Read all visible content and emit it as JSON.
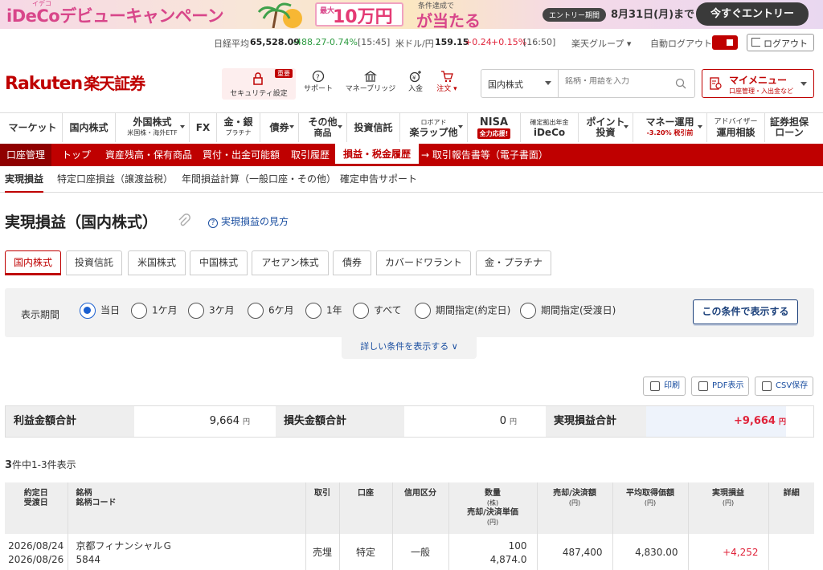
{
  "banner": {
    "title": "iDeCoデビューキャンペーン",
    "ruby": "イデコ",
    "prize_small": "最大",
    "prize_amount": "10万円",
    "condition": "条件達成で",
    "atari": "が当たる",
    "period_tag": "エントリー期間",
    "period_date": "8月31日(月)まで",
    "cta": "今すぐエントリー"
  },
  "ticker": {
    "nikkei_label": "日経平均",
    "nikkei_value": "65,528.09",
    "nikkei_change": "-488.27",
    "nikkei_pct": "-0.74%",
    "nikkei_time": "[15:45]",
    "usdjpy_label": "米ドル/円",
    "usdjpy_value": "159.15",
    "usdjpy_change": "+0.24",
    "usdjpy_pct": "+0.15%",
    "usdjpy_time": "[16:50]",
    "group_label": "楽天グループ ▾",
    "auto_logout_label": "自動ログアウト",
    "logout_button": "ログアウト"
  },
  "header": {
    "logo_en": "Rakuten",
    "logo_jp": "楽天証券",
    "security_label": "セキュリティ設定",
    "security_badge": "重要",
    "icons": [
      {
        "name": "サポート"
      },
      {
        "name": "マネーブリッジ"
      },
      {
        "name": "入金"
      },
      {
        "name": "注文 ▾"
      }
    ],
    "search_select": "国内株式",
    "search_placeholder": "銘柄・用語を入力",
    "mymenu_title": "マイメニュー",
    "mymenu_sub": "口座管理・入出金など"
  },
  "nav": [
    {
      "line1": "マーケット",
      "line2": ""
    },
    {
      "line1": "国内株式",
      "line2": ""
    },
    {
      "line1": "外国株式",
      "line2": "米国株・海外ETF"
    },
    {
      "line1": "FX",
      "line2": ""
    },
    {
      "line1": "金・銀",
      "line2": "プラチナ"
    },
    {
      "line1": "債券",
      "line2": ""
    },
    {
      "line1": "その他",
      "line2": "商品"
    },
    {
      "line1": "投資信託",
      "line2": ""
    },
    {
      "line1": "ロボアド",
      "line2": "楽ラップ他"
    },
    {
      "line1": "NISA",
      "line2": "全力応援!"
    },
    {
      "line1": "確定拠出年金",
      "line2": "iDeCo"
    },
    {
      "line1": "ポイント",
      "line2": "投資"
    },
    {
      "line1": "マネー運用",
      "line2": "-3.20% 税引前"
    },
    {
      "line1": "アドバイザー",
      "line2": "運用相談"
    },
    {
      "line1": "証券担保",
      "line2": "ローン"
    }
  ],
  "account_bar": {
    "head": "口座管理",
    "items": [
      "トップ",
      "資産残高・保有商品",
      "買付・出金可能額",
      "取引履歴",
      "損益・税金履歴",
      "→ 取引報告書等（電子書面）"
    ]
  },
  "subtabs": [
    "実現損益",
    "特定口座損益（譲渡益税）",
    "年間損益計算（一般口座・その他）",
    "確定申告サポート"
  ],
  "page": {
    "title": "実現損益（国内株式）",
    "help_link": "実現損益の見方"
  },
  "market_tabs": [
    "国内株式",
    "投資信託",
    "米国株式",
    "中国株式",
    "アセアン株式",
    "債券",
    "カバードワラント",
    "金・プラチナ"
  ],
  "filter": {
    "label": "表示期間",
    "options": [
      "当日",
      "1ケ月",
      "3ケ月",
      "6ケ月",
      "1年",
      "すべて",
      "期間指定(約定日)",
      "期間指定(受渡日)"
    ],
    "selected": "当日",
    "show_button": "この条件で表示する",
    "more_conditions": "詳しい条件を表示する ∨"
  },
  "tools": {
    "print": "印刷",
    "pdf": "PDF表示",
    "csv": "CSV保存"
  },
  "summary": {
    "profit_label": "利益金額合計",
    "profit_value": "9,664",
    "unit": "円",
    "loss_label": "損失金額合計",
    "loss_value": "0",
    "realized_label": "実現損益合計",
    "realized_value": "+9,664"
  },
  "count": {
    "total": "3",
    "text": "件中1-3件表示"
  },
  "table": {
    "headers": {
      "date1": "約定日",
      "date2": "受渡日",
      "name1": "銘柄",
      "name2": "銘柄コード",
      "trade": "取引",
      "account": "口座",
      "credit": "信用区分",
      "qty": "数量",
      "qty_unit": "(株)",
      "price": "売却/決済単価",
      "price_unit": "(円)",
      "amount": "売却/決済額",
      "amount_unit": "(円)",
      "avgcost": "平均取得価額",
      "avgcost_unit": "(円)",
      "pl": "実現損益",
      "pl_unit": "(円)",
      "detail": "詳細"
    },
    "rows": [
      {
        "trade_date": "2026/08/24",
        "settle_date": "2026/08/26",
        "name": "京都フィナンシャルＧ",
        "code": "5844",
        "trade": "売埋",
        "account": "特定",
        "credit": "一般",
        "qty": "100",
        "price": "4,874.0",
        "amount": "487,400",
        "avgcost": "4,830.00",
        "pl": "+4,252"
      }
    ]
  }
}
